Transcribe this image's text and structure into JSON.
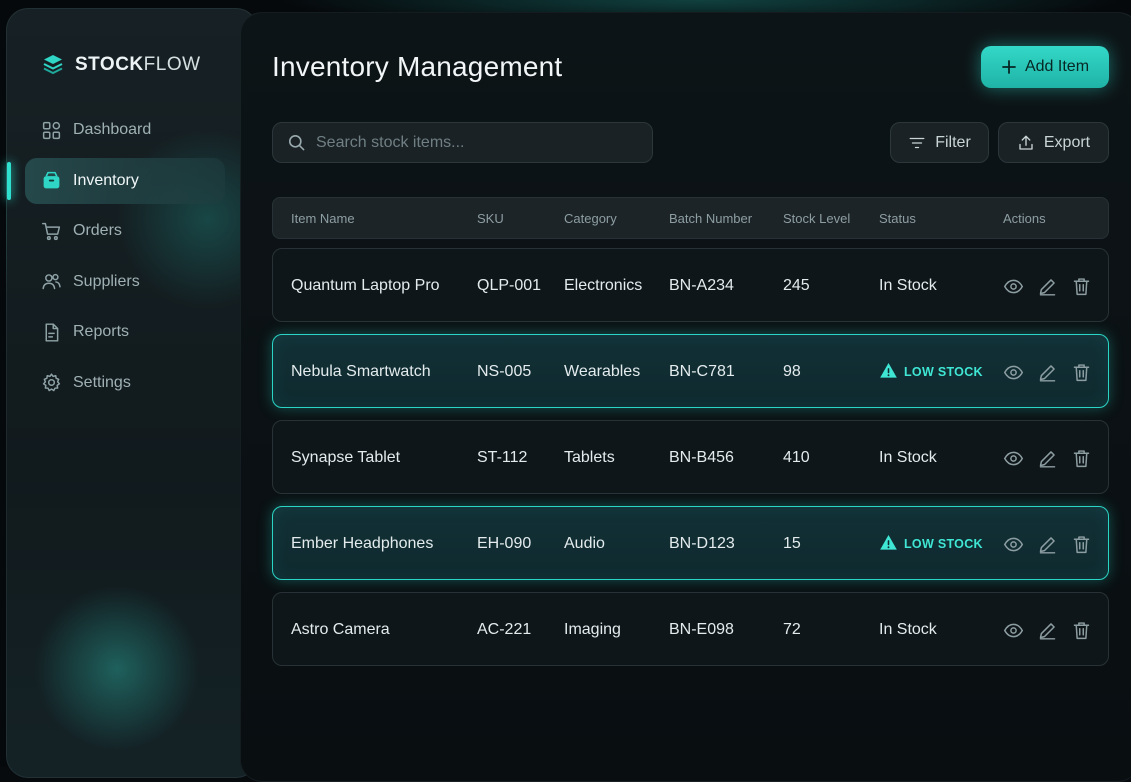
{
  "brand": {
    "bold": "STOCK",
    "light": "FLOW"
  },
  "sidebar": {
    "items": [
      {
        "label": "Dashboard",
        "icon": "grid-icon",
        "active": false
      },
      {
        "label": "Inventory",
        "icon": "box-icon",
        "active": true
      },
      {
        "label": "Orders",
        "icon": "cart-icon",
        "active": false
      },
      {
        "label": "Suppliers",
        "icon": "users-icon",
        "active": false
      },
      {
        "label": "Reports",
        "icon": "document-icon",
        "active": false
      },
      {
        "label": "Settings",
        "icon": "gear-icon",
        "active": false
      }
    ]
  },
  "header": {
    "title": "Inventory Management",
    "add_label": "Add Item"
  },
  "toolbar": {
    "search_placeholder": "Search stock items...",
    "filter_label": "Filter",
    "export_label": "Export"
  },
  "table": {
    "columns": [
      "Item Name",
      "SKU",
      "Category",
      "Batch Number",
      "Stock Level",
      "Status",
      "Actions"
    ],
    "rows": [
      {
        "name": "Quantum Laptop Pro",
        "sku": "QLP-001",
        "category": "Electronics",
        "batch": "BN-A234",
        "stock": "245",
        "status": "In Stock",
        "low": false
      },
      {
        "name": "Nebula Smartwatch",
        "sku": "NS-005",
        "category": "Wearables",
        "batch": "BN-C781",
        "stock": "98",
        "status": "LOW STOCK",
        "low": true
      },
      {
        "name": "Synapse Tablet",
        "sku": "ST-112",
        "category": "Tablets",
        "batch": "BN-B456",
        "stock": "410",
        "status": "In Stock",
        "low": false
      },
      {
        "name": "Ember Headphones",
        "sku": "EH-090",
        "category": "Audio",
        "batch": "BN-D123",
        "stock": "15",
        "status": "LOW STOCK",
        "low": true
      },
      {
        "name": "Astro Camera",
        "sku": "AC-221",
        "category": "Imaging",
        "batch": "BN-E098",
        "stock": "72",
        "status": "In Stock",
        "low": false
      }
    ]
  },
  "colors": {
    "accent": "#2fe0cf",
    "background": "#06090c",
    "panel": "#0d1417"
  }
}
